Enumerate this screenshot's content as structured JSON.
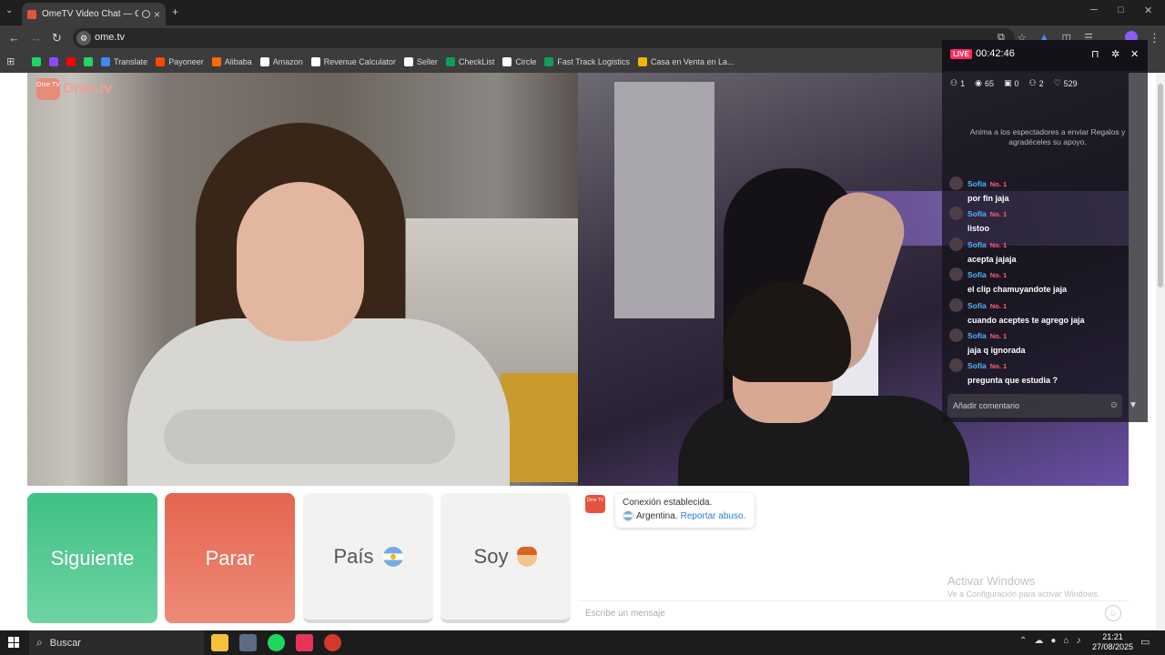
{
  "browser": {
    "tab_title": "OmeTV Video Chat — Ome",
    "tab_close": "×",
    "new_tab": "+",
    "url": "ome.tv",
    "bookmarks": [
      {
        "label": "",
        "color": "#1ed760"
      },
      {
        "label": "",
        "color": "#9146ff"
      },
      {
        "label": "",
        "color": "#ff0000"
      },
      {
        "label": "",
        "color": "#25d366"
      },
      {
        "label": "Translate",
        "color": "#4285f4"
      },
      {
        "label": "Payoneer",
        "color": "#ff4800"
      },
      {
        "label": "Alibaba",
        "color": "#ff6a00"
      },
      {
        "label": "Amazon",
        "color": "#ffffff"
      },
      {
        "label": "Revenue Calculator",
        "color": "#ffffff"
      },
      {
        "label": "Seller",
        "color": "#ffffff"
      },
      {
        "label": "CheckList",
        "color": "#0f9d58"
      },
      {
        "label": "Circle",
        "color": "#ffffff"
      },
      {
        "label": "Fast Track Logistics",
        "color": "#0f9d58"
      },
      {
        "label": "Casa en Venta en La...",
        "color": "#f4b400"
      }
    ]
  },
  "page": {
    "logo_text": "Ome.tv",
    "logo_mark": "Ome TV"
  },
  "live": {
    "badge": "LIVE",
    "time": "00:42:46",
    "stats": [
      {
        "icon": "user-icon",
        "glyph": "⚇",
        "value": "1"
      },
      {
        "icon": "eye-icon",
        "glyph": "◉",
        "value": "65"
      },
      {
        "icon": "gift-icon",
        "glyph": "▣",
        "value": "0"
      },
      {
        "icon": "users-icon",
        "glyph": "⚇",
        "value": "2"
      },
      {
        "icon": "heart-icon",
        "glyph": "♡",
        "value": "529"
      }
    ],
    "prompt": "Anima a los espectadores a enviar Regalos y agradéceles su apoyo.",
    "comments": [
      {
        "user": "Sofía",
        "rank": "No. 1",
        "text": "por fin jaja"
      },
      {
        "user": "Sofía",
        "rank": "No. 1",
        "text": "listoo"
      },
      {
        "user": "Sofía",
        "rank": "No. 1",
        "text": "acepta jajaja"
      },
      {
        "user": "Sofía",
        "rank": "No. 1",
        "text": "el clip chamuyandote jaja"
      },
      {
        "user": "Sofía",
        "rank": "No. 1",
        "text": "cuando aceptes te agrego jaja"
      },
      {
        "user": "Sofía",
        "rank": "No. 1",
        "text": "jaja q ignorada"
      },
      {
        "user": "Sofía",
        "rank": "No. 1",
        "text": "pregunta que estudia ?"
      }
    ],
    "comment_placeholder": "Añadir comentario"
  },
  "controls": {
    "next": "Siguiente",
    "stop": "Parar",
    "country": "País",
    "me": "Soy"
  },
  "chat": {
    "line1": "Conexión establecida.",
    "country": "Argentina.",
    "report": "Reportar abuso.",
    "placeholder": "Escribe un mensaje",
    "watermark_title": "Activar Windows",
    "watermark_sub": "Ve a Configuración para activar Windows."
  },
  "taskbar": {
    "search": "Buscar",
    "time": "21:21",
    "date": "27/08/2025"
  }
}
